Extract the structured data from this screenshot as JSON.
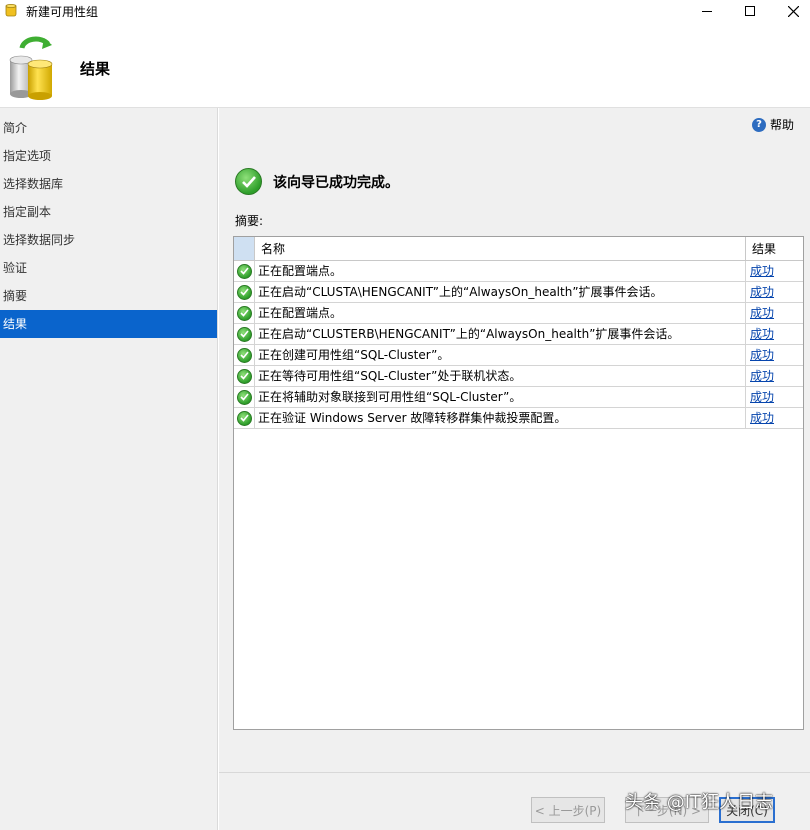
{
  "window": {
    "title": "新建可用性组",
    "colors": {
      "accent": "#0a64cc",
      "success": "#2e9e2a",
      "link": "#0645ad"
    }
  },
  "header": {
    "heading": "结果"
  },
  "nav": {
    "items": [
      {
        "label": "简介",
        "active": false
      },
      {
        "label": "指定选项",
        "active": false
      },
      {
        "label": "选择数据库",
        "active": false
      },
      {
        "label": "指定副本",
        "active": false
      },
      {
        "label": "选择数据同步",
        "active": false
      },
      {
        "label": "验证",
        "active": false
      },
      {
        "label": "摘要",
        "active": false
      },
      {
        "label": "结果",
        "active": true
      }
    ]
  },
  "main": {
    "help_label": "帮助",
    "success_message": "该向导已成功完成。",
    "summary_label": "摘要:",
    "table": {
      "columns": {
        "name": "名称",
        "result": "结果"
      },
      "rows": [
        {
          "name": "正在配置端点。",
          "result": "成功",
          "icon": "success-check-icon"
        },
        {
          "name": "正在启动“CLUSTA\\HENGCANIT”上的“AlwaysOn_health”扩展事件会话。",
          "result": "成功",
          "icon": "success-check-icon"
        },
        {
          "name": "正在配置端点。",
          "result": "成功",
          "icon": "success-check-icon"
        },
        {
          "name": "正在启动“CLUSTERB\\HENGCANIT”上的“AlwaysOn_health”扩展事件会话。",
          "result": "成功",
          "icon": "success-check-icon"
        },
        {
          "name": "正在创建可用性组“SQL-Cluster”。",
          "result": "成功",
          "icon": "success-check-icon"
        },
        {
          "name": "正在等待可用性组“SQL-Cluster”处于联机状态。",
          "result": "成功",
          "icon": "success-check-icon"
        },
        {
          "name": "正在将辅助对象联接到可用性组“SQL-Cluster”。",
          "result": "成功",
          "icon": "success-check-icon"
        },
        {
          "name": "正在验证 Windows Server 故障转移群集仲裁投票配置。",
          "result": "成功",
          "icon": "success-check-icon"
        }
      ]
    }
  },
  "footer": {
    "prev_label": "< 上一步(P)",
    "next_label": "下一步(N) >",
    "close_label": "关闭(C)"
  },
  "watermark": "头条 @IT狂人日志"
}
